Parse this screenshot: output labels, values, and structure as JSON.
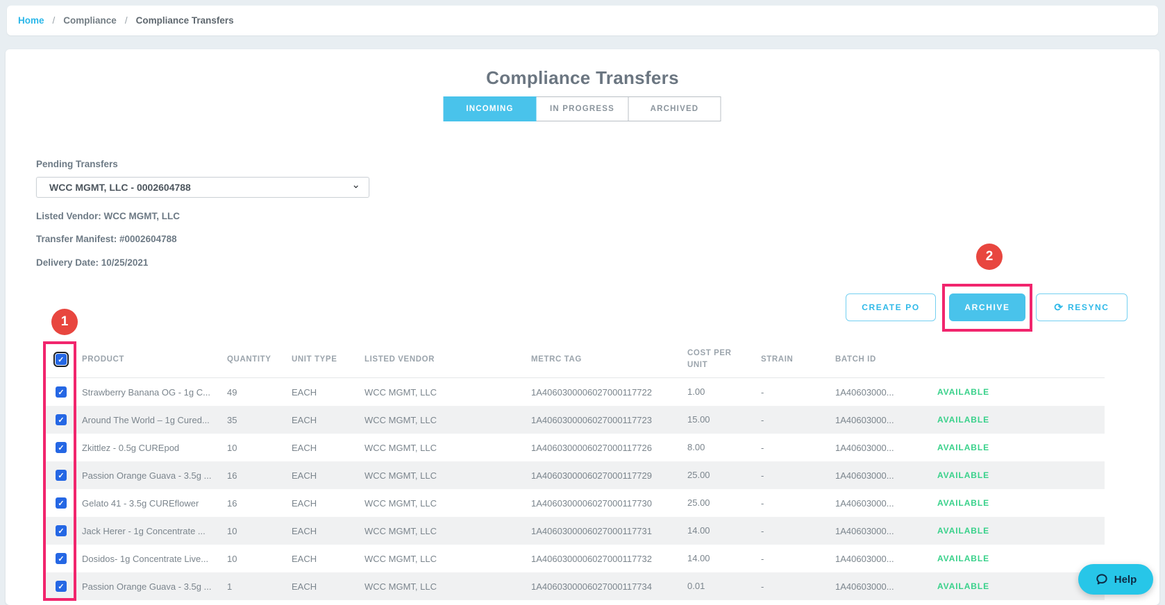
{
  "breadcrumb": {
    "separator": "/",
    "items": [
      {
        "label": "Home"
      },
      {
        "label": "Compliance"
      },
      {
        "label": "Compliance Transfers"
      }
    ]
  },
  "page": {
    "title": "Compliance Transfers"
  },
  "tabs": [
    {
      "label": "INCOMING",
      "active": true
    },
    {
      "label": "IN PROGRESS",
      "active": false
    },
    {
      "label": "ARCHIVED",
      "active": false
    }
  ],
  "filters": {
    "pending_transfers_label": "Pending Transfers",
    "selected_transfer": "WCC MGMT, LLC - 0002604788"
  },
  "details": [
    "Listed Vendor: WCC MGMT, LLC",
    "Transfer Manifest: #0002604788",
    "Delivery Date: 10/25/2021"
  ],
  "toolbar": {
    "create_po_label": "CREATE PO",
    "archive_label": "ARCHIVE",
    "resync_label": "RESYNC"
  },
  "annotations": {
    "badge1": "1",
    "badge2": "2"
  },
  "icons": {
    "resync": "⟳",
    "select_chevron": "⌄"
  },
  "table": {
    "headers": {
      "product": "PRODUCT",
      "quantity": "QUANTITY",
      "unit_type": "UNIT TYPE",
      "listed_vendor": "LISTED VENDOR",
      "metrc_tag": "METRC TAG",
      "cost_per_unit": "COST PER UNIT",
      "strain": "STRAIN",
      "batch_id": "BATCH ID"
    },
    "rows": [
      {
        "product": "Strawberry Banana OG - 1g C...",
        "quantity": "49",
        "unit_type": "EACH",
        "listed_vendor": "WCC MGMT, LLC",
        "metrc_tag": "1A4060300006027000117722",
        "cost_per_unit": "1.00",
        "strain": "-",
        "batch_id": "1A40603000...",
        "status": "AVAILABLE"
      },
      {
        "product": "Around The World – 1g Cured...",
        "quantity": "35",
        "unit_type": "EACH",
        "listed_vendor": "WCC MGMT, LLC",
        "metrc_tag": "1A4060300006027000117723",
        "cost_per_unit": "15.00",
        "strain": "-",
        "batch_id": "1A40603000...",
        "status": "AVAILABLE"
      },
      {
        "product": "Zkittlez - 0.5g CUREpod",
        "quantity": "10",
        "unit_type": "EACH",
        "listed_vendor": "WCC MGMT, LLC",
        "metrc_tag": "1A4060300006027000117726",
        "cost_per_unit": "8.00",
        "strain": "-",
        "batch_id": "1A40603000...",
        "status": "AVAILABLE"
      },
      {
        "product": "Passion Orange Guava - 3.5g ...",
        "quantity": "16",
        "unit_type": "EACH",
        "listed_vendor": "WCC MGMT, LLC",
        "metrc_tag": "1A4060300006027000117729",
        "cost_per_unit": "25.00",
        "strain": "-",
        "batch_id": "1A40603000...",
        "status": "AVAILABLE"
      },
      {
        "product": "Gelato 41 - 3.5g CUREflower",
        "quantity": "16",
        "unit_type": "EACH",
        "listed_vendor": "WCC MGMT, LLC",
        "metrc_tag": "1A4060300006027000117730",
        "cost_per_unit": "25.00",
        "strain": "-",
        "batch_id": "1A40603000...",
        "status": "AVAILABLE"
      },
      {
        "product": "Jack Herer - 1g Concentrate ...",
        "quantity": "10",
        "unit_type": "EACH",
        "listed_vendor": "WCC MGMT, LLC",
        "metrc_tag": "1A4060300006027000117731",
        "cost_per_unit": "14.00",
        "strain": "-",
        "batch_id": "1A40603000...",
        "status": "AVAILABLE"
      },
      {
        "product": "Dosidos- 1g Concentrate Live...",
        "quantity": "10",
        "unit_type": "EACH",
        "listed_vendor": "WCC MGMT, LLC",
        "metrc_tag": "1A4060300006027000117732",
        "cost_per_unit": "14.00",
        "strain": "-",
        "batch_id": "1A40603000...",
        "status": "AVAILABLE"
      },
      {
        "product": "Passion Orange Guava - 3.5g ...",
        "quantity": "1",
        "unit_type": "EACH",
        "listed_vendor": "WCC MGMT, LLC",
        "metrc_tag": "1A4060300006027000117734",
        "cost_per_unit": "0.01",
        "strain": "-",
        "batch_id": "1A40603000...",
        "status": "AVAILABLE"
      }
    ]
  },
  "help": {
    "label": "Help"
  },
  "colors": {
    "accent_blue": "#49c3eb",
    "link_blue": "#2bb7e9",
    "annotation_pink": "#f1256d",
    "badge_red": "#e8463f",
    "status_green": "#38d18a",
    "checkbox_blue": "#2567e4",
    "help_teal": "#27c6e8",
    "page_background": "#e8eef2"
  }
}
